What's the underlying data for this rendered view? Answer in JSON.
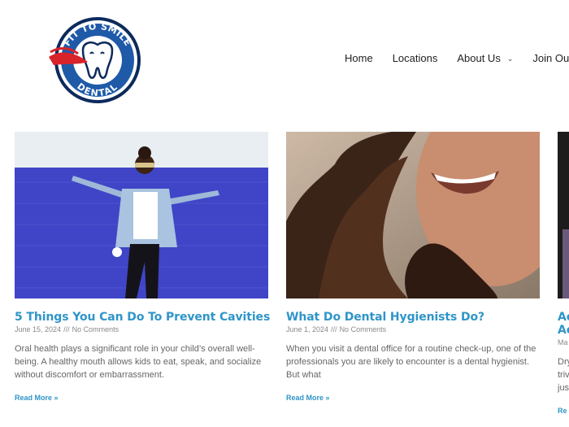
{
  "brand": {
    "logo_text_top": "FIT TO SMILE",
    "logo_text_bottom": "DENTAL",
    "colors": {
      "blue": "#1f5aa8",
      "red": "#d8232a",
      "navy": "#0d2a5c"
    }
  },
  "nav": {
    "items": [
      {
        "label": "Home"
      },
      {
        "label": "Locations"
      },
      {
        "label": "About Us",
        "has_dropdown": true
      },
      {
        "label": "Join Our T"
      }
    ]
  },
  "posts": [
    {
      "title": "5 Things You Can Do To Prevent Cavities",
      "date": "June 15, 2024",
      "separator": "///",
      "comments": "No Comments",
      "excerpt": "Oral health plays a significant role in your child’s overall well-being. A healthy mouth allows kids to eat, speak, and socialize without discomfort or embarrassment.",
      "read_more": "Read More »"
    },
    {
      "title": "What Do Dental Hygienists Do?",
      "date": "June 1, 2024",
      "separator": "///",
      "comments": "No Comments",
      "excerpt": "When you visit a dental office for a routine check-up, one of the professionals you are likely to encounter is a dental hygienist. But what",
      "read_more": "Read More »"
    },
    {
      "title_line1": "Ac",
      "title_line2": "Ac",
      "meta": "Ma",
      "excerpt_lines": [
        "Dry",
        "triv",
        "jus"
      ],
      "read_more": "Re"
    }
  ],
  "colors": {
    "accent": "#2f95c8",
    "meta": "#888888",
    "text": "#666666"
  }
}
